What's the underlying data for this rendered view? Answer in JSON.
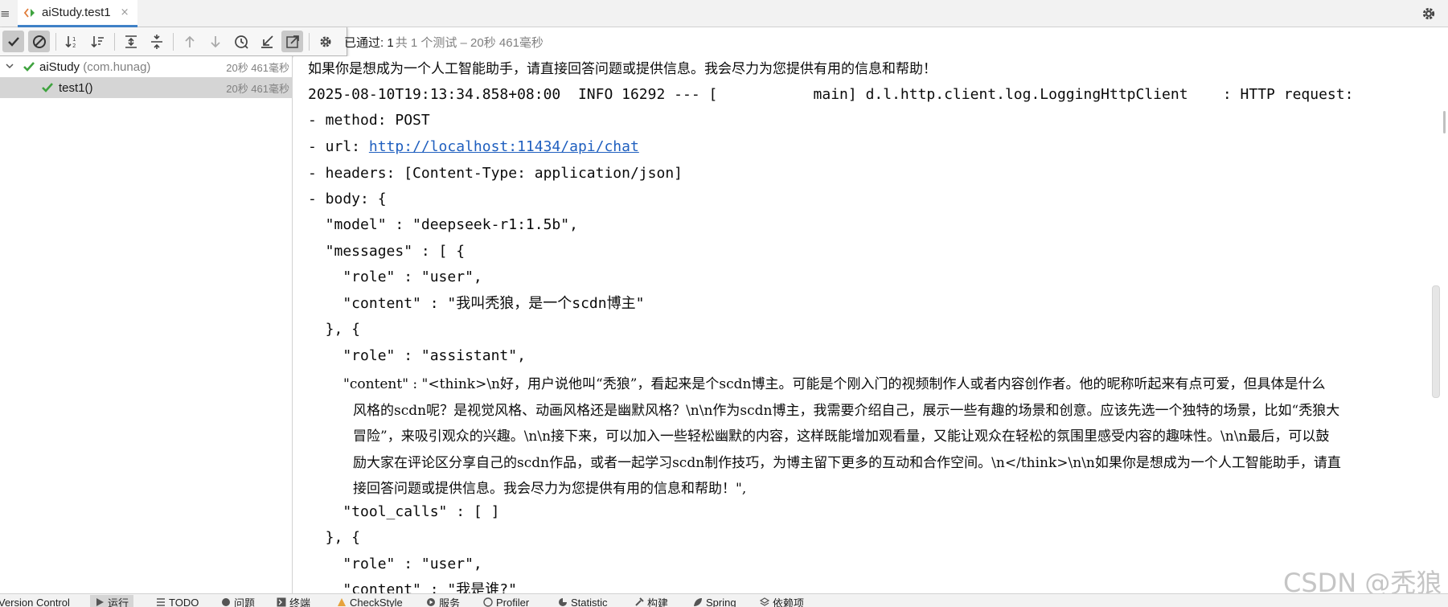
{
  "tab": {
    "left_edge": "≡",
    "label": "aiStudy.test1",
    "close": "×"
  },
  "status": {
    "passed": "已通过: 1",
    "detail": "共 1 个测试 – 20秒 461毫秒"
  },
  "tree": [
    {
      "name": "aiStudy",
      "pkg": "(com.hunag)",
      "time": "20秒 461毫秒",
      "selected": false
    },
    {
      "name": "test1()",
      "pkg": "",
      "time": "20秒 461毫秒",
      "selected": true
    }
  ],
  "console": {
    "lines": [
      "如果你是想成为一个人工智能助手，请直接回答问题或提供信息。我会尽力为您提供有用的信息和帮助！",
      "2025-08-10T19:13:34.858+08:00  INFO 16292 --- [           main] d.l.http.client.log.LoggingHttpClient    : HTTP request:",
      "- method: POST",
      "- url: ",
      "- headers: [Content-Type: application/json]",
      "- body: {",
      "  \"model\" : \"deepseek-r1:1.5b\",",
      "  \"messages\" : [ {",
      "    \"role\" : \"user\",",
      "    \"content\" : \"我叫秃狼，是一个scdn博主\"",
      "  }, {",
      "    \"role\" : \"assistant\","
    ],
    "url": "http://localhost:11434/api/chat",
    "content_wrapped": [
      "\"content\" : \"<think>\\n好，用户说他叫“秃狼”，看起来是个scdn博主。可能是个刚入门的视频制作人或者内容创作者。他的昵称听起来有点可爱，但具体是什么",
      "风格的scdn呢？是视觉风格、动画风格还是幽默风格？\\n\\n作为scdn博主，我需要介绍自己，展示一些有趣的场景和创意。应该先选一个独特的场景，比如“秃狼大",
      "冒险”，来吸引观众的兴趣。\\n\\n接下来，可以加入一些轻松幽默的内容，这样既能增加观看量，又能让观众在轻松的氛围里感受内容的趣味性。\\n\\n最后，可以鼓",
      "励大家在评论区分享自己的scdn作品，或者一起学习scdn制作技巧，为博主留下更多的互动和合作空间。\\n</think>\\n\\n如果你是想成为一个人工智能助手，请直",
      "接回答问题或提供信息。我会尽力为您提供有用的信息和帮助！\","
    ],
    "tail_lines": [
      "    \"tool_calls\" : [ ]",
      "  }, {",
      "    \"role\" : \"user\",",
      "    \"content\" : \"我是谁?\""
    ]
  },
  "watermark": "CSDN @秃狼",
  "bottom_tools": [
    {
      "label": "Version Control",
      "icon": "git-branch-icon"
    },
    {
      "label": "运行",
      "icon": "run-icon",
      "active": true
    },
    {
      "label": "TODO",
      "icon": "list-icon"
    },
    {
      "label": "问题",
      "icon": "problems-icon"
    },
    {
      "label": "终端",
      "icon": "terminal-icon"
    },
    {
      "label": "CheckStyle",
      "icon": "checkstyle-icon"
    },
    {
      "label": "服务",
      "icon": "services-icon"
    },
    {
      "label": "Profiler",
      "icon": "profiler-icon"
    },
    {
      "label": "Statistic",
      "icon": "statistic-icon"
    },
    {
      "label": "构建",
      "icon": "build-icon"
    },
    {
      "label": "Spring",
      "icon": "spring-icon"
    },
    {
      "label": "依赖项",
      "icon": "dependencies-icon"
    }
  ],
  "colors": {
    "pass_green": "#3fa33f",
    "link_blue": "#1f5fbf",
    "accent_tab": "#4083c9"
  }
}
